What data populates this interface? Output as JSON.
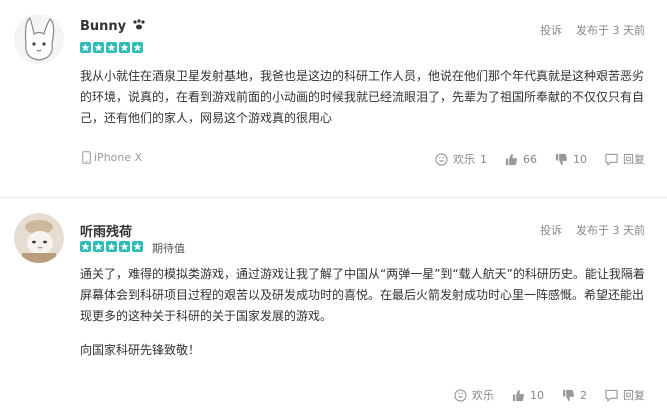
{
  "reviews": [
    {
      "username": "Bunny",
      "rating": 5,
      "tag": "",
      "report_label": "投诉",
      "posted_label": "发布于 3 天前",
      "paragraphs": [
        "我从小就住在酒泉卫星发射基地，我爸也是这边的科研工作人员，他说在他们那个年代真就是这种艰苦恶劣的环境，说真的，在看到游戏前面的小动画的时候我就已经流眼泪了，先辈为了祖国所奉献的不仅仅只有自己，还有他们的家人，网易这个游戏真的很用心"
      ],
      "device": "iPhone X",
      "fun_label": "欢乐",
      "fun_count": "1",
      "like_count": "66",
      "dislike_count": "10",
      "reply_label": "回复"
    },
    {
      "username": "听雨残荷",
      "rating": 5,
      "tag": "期待值",
      "report_label": "投诉",
      "posted_label": "发布于 3 天前",
      "paragraphs": [
        "通关了，难得的模拟类游戏，通过游戏让我了解了中国从“两弹一星”到“载人航天”的科研历史。能让我隔着屏幕体会到科研项目过程的艰苦以及研发成功时的喜悦。在最后火箭发射成功时心里一阵感慨。希望还能出现更多的这种关于科研的关于国家发展的游戏。",
        "向国家科研先锋致敬！"
      ],
      "device": "",
      "fun_label": "欢乐",
      "fun_count": "",
      "like_count": "10",
      "dislike_count": "2",
      "reply_label": "回复"
    }
  ],
  "colors": {
    "star": "#2dbcb6",
    "muted": "#888888",
    "divider": "#e8e8e8"
  },
  "icons": [
    "phone-icon",
    "laugh-icon",
    "thumbs-up-icon",
    "thumbs-down-icon",
    "reply-icon",
    "paw-icon",
    "star-icon"
  ]
}
